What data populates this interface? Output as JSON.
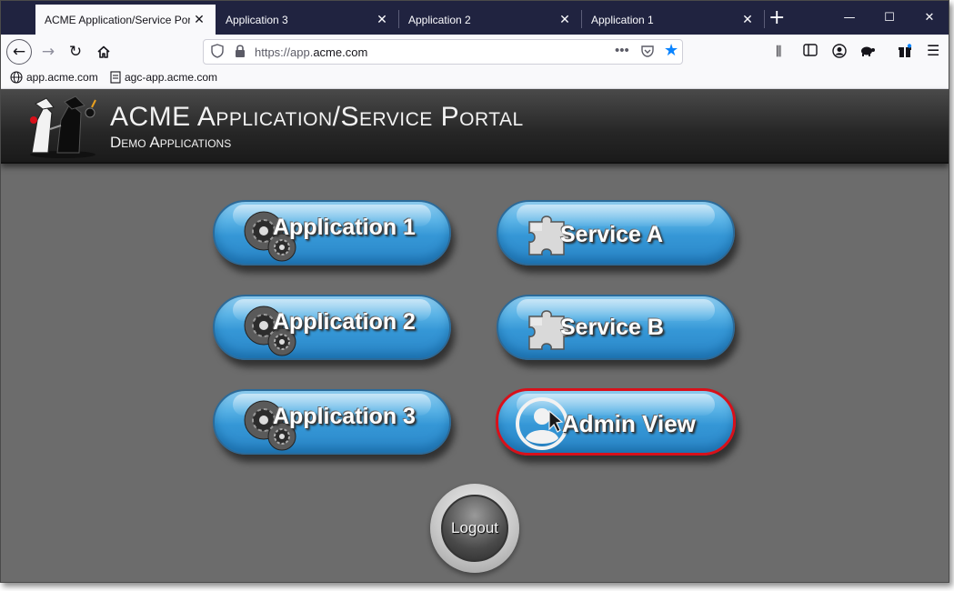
{
  "browser": {
    "tabs": [
      {
        "title": "ACME Application/Service Portal",
        "active": true
      },
      {
        "title": "Application 3",
        "active": false
      },
      {
        "title": "Application 2",
        "active": false
      },
      {
        "title": "Application 1",
        "active": false
      }
    ],
    "url": {
      "prefix": "https://app.",
      "domain": "acme.com"
    },
    "bookmarks": [
      {
        "label": "app.acme.com",
        "icon": "globe-icon"
      },
      {
        "label": "agc-app.acme.com",
        "icon": "page-icon"
      }
    ]
  },
  "portal": {
    "title": "ACME Application/Service Portal",
    "subtitle": "Demo Applications",
    "buttons": {
      "app1": "Application 1",
      "app2": "Application 2",
      "app3": "Application 3",
      "svcA": "Service A",
      "svcB": "Service B",
      "admin": "Admin View"
    },
    "logout": "Logout",
    "selected_button": "Admin View",
    "selection_color": "#d8101a",
    "button_color": "#3597d6"
  }
}
